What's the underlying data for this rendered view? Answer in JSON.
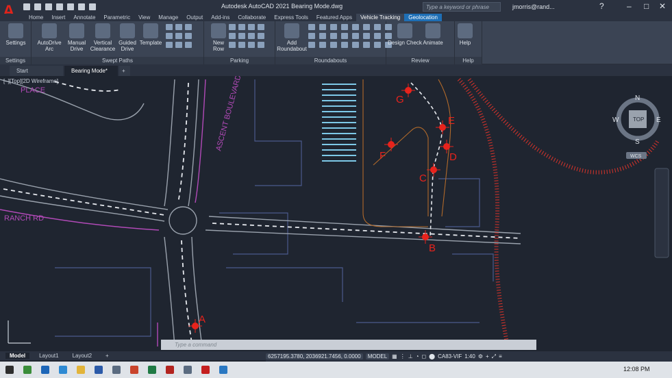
{
  "titlebar": {
    "title": "Autodesk AutoCAD 2021    Bearing Mode.dwg",
    "search_placeholder": "Type a keyword or phrase",
    "user": "jmorris@rand...",
    "help": "?"
  },
  "ribbon_tabs": [
    "Home",
    "Insert",
    "Annotate",
    "Parametric",
    "View",
    "Manage",
    "Output",
    "Add-ins",
    "Collaborate",
    "Express Tools",
    "Featured Apps",
    "Vehicle Tracking",
    "Geolocation"
  ],
  "ribbon": {
    "settings": {
      "title": "Settings",
      "btn": "Settings"
    },
    "swept": {
      "title": "Swept Paths",
      "buttons": [
        "AutoDrive Arc",
        "Manual Drive",
        "Vertical Clearance",
        "Guided Drive",
        "Template"
      ]
    },
    "parking": {
      "title": "Parking",
      "btn": "New Row"
    },
    "roundabouts": {
      "title": "Roundabouts",
      "btn": "Add Roundabout"
    },
    "review": {
      "title": "Review",
      "buttons": [
        "Design Check",
        "Animate"
      ]
    },
    "help": {
      "title": "Help",
      "btn": "Help"
    }
  },
  "doc_tabs": [
    "Start",
    "Bearing Mode*"
  ],
  "viewport": {
    "label": "[–][Top][2D Wireframe]",
    "streets": [
      "ASCENT BOULEVARD",
      "RANCH RD",
      "PLACE"
    ],
    "points": [
      "A",
      "B",
      "C",
      "D",
      "E",
      "F",
      "G"
    ],
    "viewcube": {
      "n": "N",
      "s": "S",
      "e": "E",
      "w": "W",
      "top": "TOP",
      "wcs": "WCS"
    }
  },
  "command_placeholder": "Type a command",
  "layout_tabs": [
    "Model",
    "Layout1",
    "Layout2"
  ],
  "status": {
    "coords": "6257195.3780, 2036921.7456, 0.0000",
    "model": "MODEL",
    "coord_sys": "CA83-VIF",
    "scale": "1:40"
  },
  "taskbar": {
    "time": "12:08 PM"
  }
}
